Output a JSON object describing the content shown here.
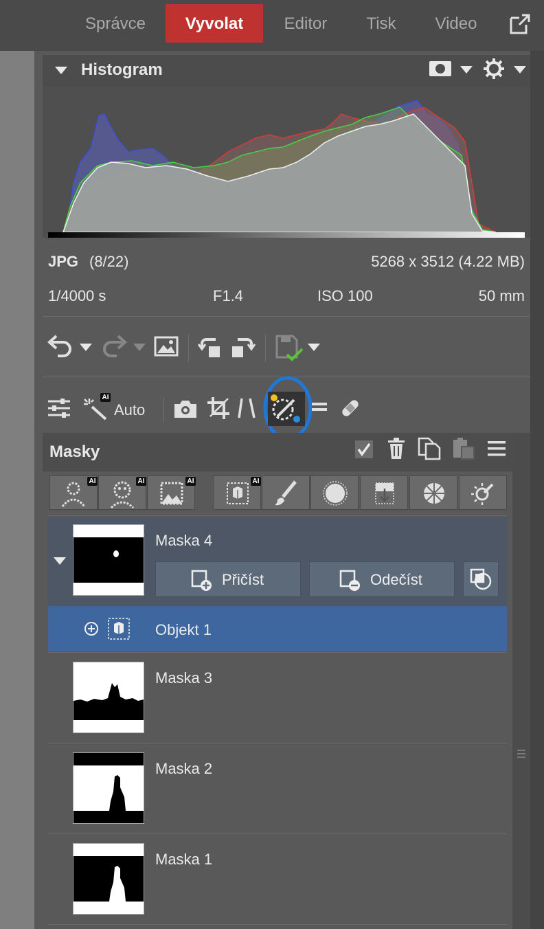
{
  "nav": {
    "tabs": [
      {
        "label": "Správce"
      },
      {
        "label": "Vyvolat"
      },
      {
        "label": "Editor"
      },
      {
        "label": "Tisk"
      },
      {
        "label": "Video"
      }
    ],
    "active_tab": "Vyvolat"
  },
  "histogram": {
    "title": "Histogram"
  },
  "file_info": {
    "format": "JPG",
    "index": "(8/22)",
    "dimensions": "5268 x 3512 (4.22 MB)",
    "shutter": "1/4000 s",
    "aperture": "F1.4",
    "iso": "ISO 100",
    "focal": "50 mm"
  },
  "tools": {
    "auto_label": "Auto",
    "ai_badge": "AI"
  },
  "masks": {
    "title": "Masky",
    "add_label": "Přičíst",
    "subtract_label": "Odečíst",
    "items": [
      {
        "name": "Maska 4"
      },
      {
        "name": "Objekt 1"
      },
      {
        "name": "Maska 3"
      },
      {
        "name": "Maska 2"
      },
      {
        "name": "Maska 1"
      }
    ]
  },
  "colors": {
    "active_tab": "#c0322f",
    "selected_row": "#3d679e",
    "highlight_ring": "#1e78d8"
  }
}
